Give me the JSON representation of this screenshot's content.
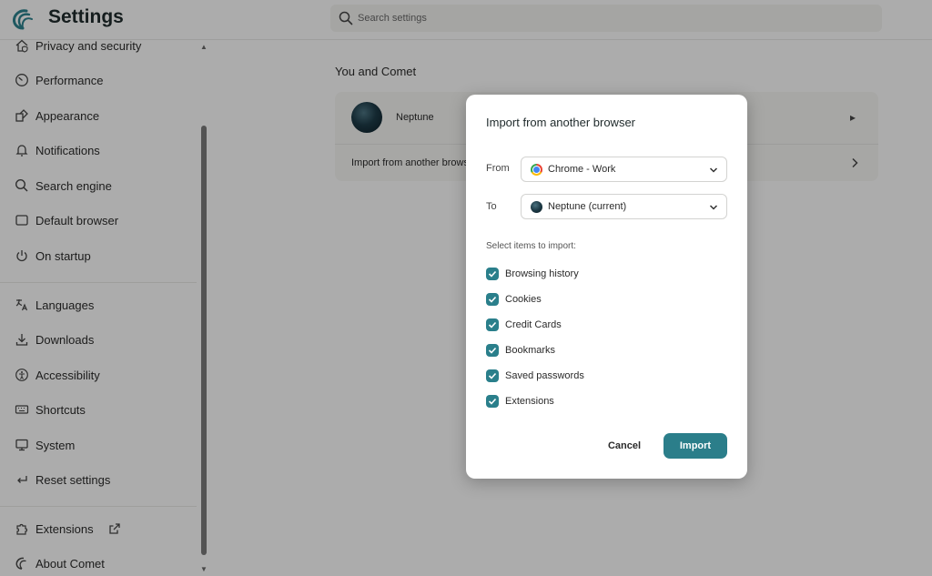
{
  "header": {
    "app_title": "Settings",
    "search_placeholder": "Search settings"
  },
  "sidebar": {
    "items": [
      {
        "label": "Privacy and security",
        "icon": "home-shield-icon"
      },
      {
        "label": "Performance",
        "icon": "gauge-icon"
      },
      {
        "label": "Appearance",
        "icon": "palette-icon"
      },
      {
        "label": "Notifications",
        "icon": "bell-icon"
      },
      {
        "label": "Search engine",
        "icon": "search-icon"
      },
      {
        "label": "Default browser",
        "icon": "browser-window-icon"
      },
      {
        "label": "On startup",
        "icon": "power-icon"
      },
      {
        "label": "Languages",
        "icon": "translate-icon"
      },
      {
        "label": "Downloads",
        "icon": "download-icon"
      },
      {
        "label": "Accessibility",
        "icon": "accessibility-icon"
      },
      {
        "label": "Shortcuts",
        "icon": "keyboard-icon"
      },
      {
        "label": "System",
        "icon": "monitor-icon"
      },
      {
        "label": "Reset settings",
        "icon": "reset-icon"
      },
      {
        "label": "Extensions",
        "icon": "puzzle-icon"
      },
      {
        "label": "About Comet",
        "icon": "comet-logo-icon"
      }
    ]
  },
  "main": {
    "section_title": "You and Comet",
    "profile_name": "Neptune",
    "import_link": "Import from another browser"
  },
  "dialog": {
    "title": "Import from another browser",
    "from_label": "From",
    "from_value": "Chrome - Work",
    "to_label": "To",
    "to_value": "Neptune (current)",
    "items_label": "Select items to import:",
    "items": [
      {
        "label": "Browsing history",
        "checked": true
      },
      {
        "label": "Cookies",
        "checked": true
      },
      {
        "label": "Credit Cards",
        "checked": true
      },
      {
        "label": "Bookmarks",
        "checked": true
      },
      {
        "label": "Saved passwords",
        "checked": true
      },
      {
        "label": "Extensions",
        "checked": true
      }
    ],
    "cancel_label": "Cancel",
    "import_label": "Import"
  },
  "colors": {
    "accent": "#2b7e8a",
    "background": "#f7f7f6"
  }
}
